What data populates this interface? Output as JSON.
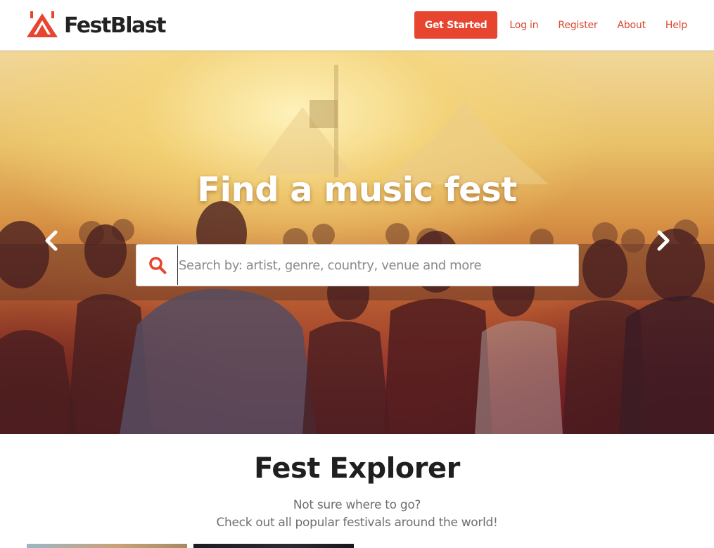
{
  "header": {
    "logo_text": "FestBlast",
    "get_started_label": "Get Started",
    "nav_links": [
      "Log in",
      "Register",
      "About",
      "Help"
    ]
  },
  "hero": {
    "title": "Find a music fest",
    "search": {
      "placeholder": "Search by: artist, genre, country, venue and more",
      "value": ""
    },
    "prev_icon": "chevron-left-icon",
    "next_icon": "chevron-right-icon"
  },
  "explorer": {
    "title": "Fest Explorer",
    "subtitle_line1": "Not sure where to go?",
    "subtitle_line2": "Check out all popular festivals around the world!"
  },
  "colors": {
    "brand_red": "#e7452f",
    "link_red": "#d9472f",
    "heading": "#1f1f1f",
    "muted_text": "#6f6f6f"
  }
}
